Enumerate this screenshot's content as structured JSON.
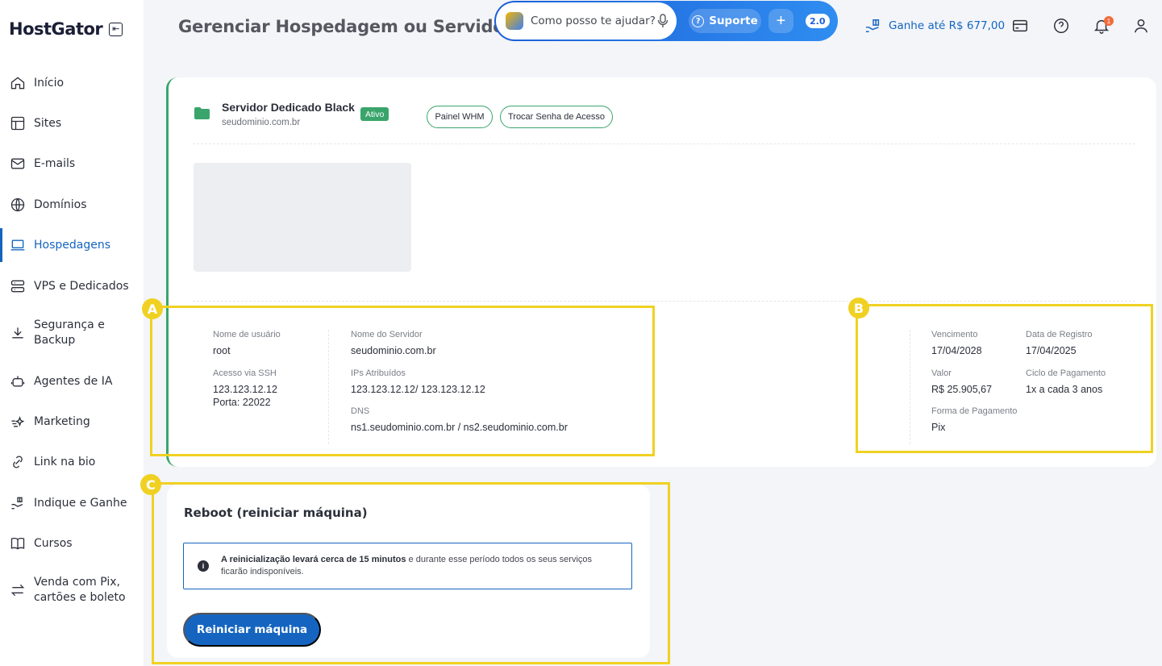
{
  "app": {
    "brand": "HostGator",
    "collapse_icon": "collapse-sidebar-icon"
  },
  "sidebar": {
    "items": [
      {
        "label": "Início",
        "icon": "home-icon"
      },
      {
        "label": "Sites",
        "icon": "layout-icon"
      },
      {
        "label": "E-mails",
        "icon": "mail-icon"
      },
      {
        "label": "Domínios",
        "icon": "globe-icon"
      },
      {
        "label": "Hospedagens",
        "icon": "laptop-icon",
        "active": true
      },
      {
        "label": "VPS e Dedicados",
        "icon": "server-icon"
      },
      {
        "label": "Segurança e",
        "label2": "Backup",
        "icon": "download-icon"
      },
      {
        "label": "Agentes de IA",
        "icon": "robot-icon"
      },
      {
        "label": "Marketing",
        "icon": "sparkles-icon"
      },
      {
        "label": "Link na bio",
        "icon": "link-icon"
      },
      {
        "label": "Indique e Ganhe",
        "icon": "hand-gift-icon"
      },
      {
        "label": "Cursos",
        "icon": "book-icon"
      },
      {
        "label": "Venda com Pix,",
        "label2": "cartões e boleto",
        "icon": "transfer-icon"
      }
    ]
  },
  "header": {
    "title": "Gerenciar Hospedagem ou Servidor",
    "assistant_placeholder": "Como posso te ajudar?",
    "support_label": "Suporte",
    "plus_label": "+",
    "version": "2.0",
    "referral_label": "Ganhe até R$ 677,00",
    "notification_count": "1"
  },
  "server": {
    "name": "Servidor Dedicado Black",
    "domain": "seudominio.com.br",
    "status": "Ativo",
    "whm_button": "Painel WHM",
    "password_button": "Trocar Senha de Acesso",
    "details": {
      "username_label": "Nome de usuário",
      "username": "root",
      "ssh_label": "Acesso via SSH",
      "ssh_ip": "123.123.12.12",
      "ssh_port": "Porta: 22022",
      "server_name_label": "Nome do Servidor",
      "server_name": "seudominio.com.br",
      "ips_label": "IPs Atribuídos",
      "ips": "123.123.12.12/ 123.123.12.12",
      "dns_label": "DNS",
      "dns": "ns1.seudominio.com.br / ns2.seudominio.com.br"
    },
    "billing": {
      "due_label": "Vencimento",
      "due": "17/04/2028",
      "registered_label": "Data de Registro",
      "registered": "17/04/2025",
      "value_label": "Valor",
      "value": "R$ 25.905,67",
      "cycle_label": "Ciclo de Pagamento",
      "cycle": "1x a cada 3 anos",
      "payment_label": "Forma de Pagamento",
      "payment": "Pix"
    }
  },
  "reboot": {
    "title": "Reboot (reiniciar máquina)",
    "info_bold": "A reinicialização levará cerca de 15 minutos",
    "info_rest": " e durante esse período todos os seus serviços ficarão indisponíveis.",
    "button": "Reiniciar máquina"
  },
  "annotations": [
    "A",
    "B",
    "C"
  ],
  "colors": {
    "accent": "#1565c0",
    "success": "#3aa56b",
    "annotation": "#f0d122",
    "notification": "#f26b3a"
  }
}
